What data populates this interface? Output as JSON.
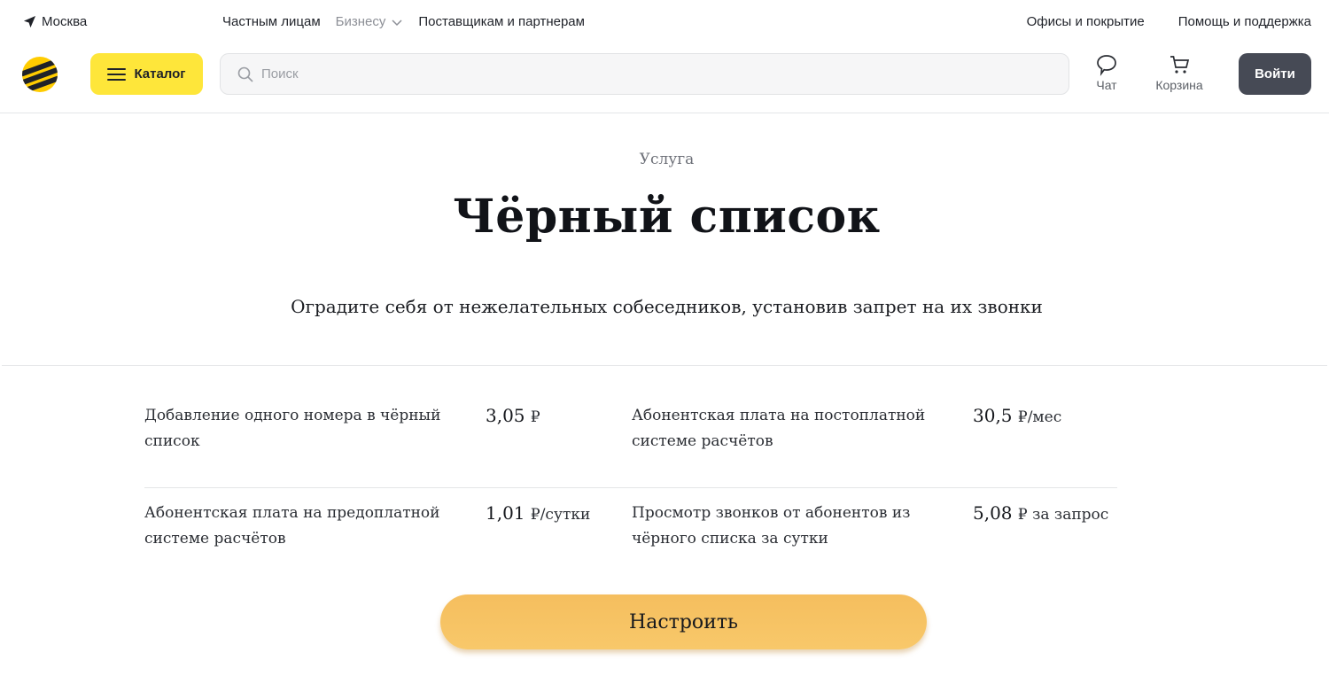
{
  "topbar": {
    "city": "Москва",
    "nav": [
      "Частным лицам",
      "Бизнесу",
      "Поставщикам и партнерам"
    ],
    "right": [
      "Офисы и покрытие",
      "Помощь и поддержка"
    ]
  },
  "header": {
    "catalog_label": "Каталог",
    "search_placeholder": "Поиск",
    "chat_label": "Чат",
    "cart_label": "Корзина",
    "login_label": "Войти"
  },
  "hero": {
    "eyebrow": "Услуга",
    "title": "Чёрный список",
    "subtitle": "Оградите себя от нежелательных собеседников, установив запрет на их звонки"
  },
  "prices": [
    {
      "label": "Добавление одного номера в чёрный список",
      "amount": "3,05",
      "unit": "₽"
    },
    {
      "label": "Абонентская плата на постоплатной системе расчётов",
      "amount": "30,5",
      "unit": "₽/мес"
    },
    {
      "label": "Абонентская плата на предоплатной системе расчётов",
      "amount": "1,01",
      "unit": "₽/сутки"
    },
    {
      "label": "Просмотр звонков от абонентов из чёрного списка за сутки",
      "amount": "5,08",
      "unit": "₽ за запрос"
    }
  ],
  "cta_label": "Настроить",
  "colors": {
    "brand_yellow": "#fee63a",
    "dark_button": "#464a55",
    "cta": "#f6c363"
  }
}
